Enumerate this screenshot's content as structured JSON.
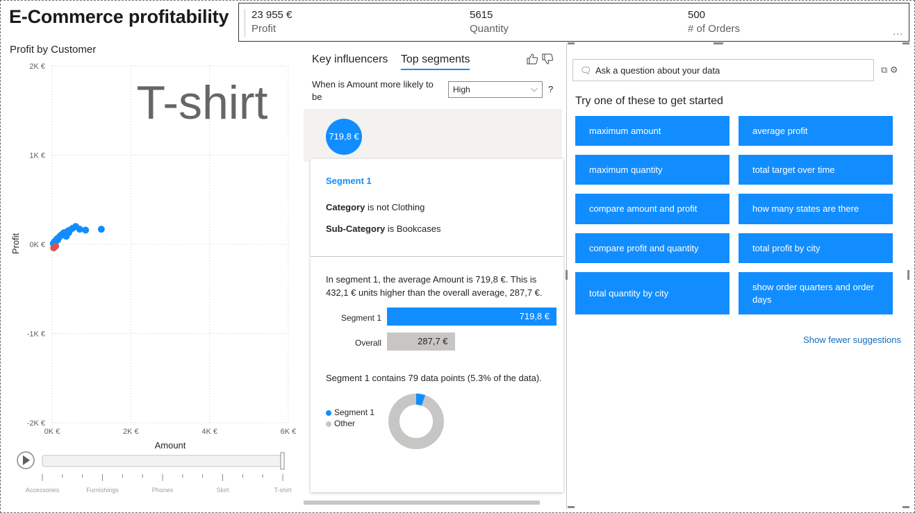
{
  "header": {
    "title": "E-Commerce profitability"
  },
  "kpis": [
    {
      "value": "23 955 €",
      "label": "Profit"
    },
    {
      "value": "5615",
      "label": "Quantity"
    },
    {
      "value": "500",
      "label": "# of Orders"
    }
  ],
  "kpi_more": "...",
  "scatter": {
    "play_axis_current": "T-shirt",
    "play_axis_categories": [
      "Accessories",
      "Furnishings",
      "Phones",
      "Skirt",
      "T-shirt"
    ]
  },
  "chart_data": {
    "type": "scatter",
    "title": "Profit by Customer",
    "xlabel": "Amount",
    "ylabel": "Profit",
    "xlim": [
      0,
      6000
    ],
    "ylim": [
      -2000,
      2000
    ],
    "x_ticks": [
      "0K €",
      "2K €",
      "4K €",
      "6K €"
    ],
    "y_ticks": [
      "2K €",
      "1K €",
      "0K €",
      "-1K €",
      "-2K €"
    ],
    "grid": true,
    "series": [
      {
        "color": "#118dff",
        "points": [
          [
            30,
            10
          ],
          [
            60,
            30
          ],
          [
            80,
            20
          ],
          [
            100,
            40
          ],
          [
            120,
            60
          ],
          [
            140,
            50
          ],
          [
            160,
            70
          ],
          [
            180,
            80
          ],
          [
            200,
            90
          ],
          [
            220,
            100
          ],
          [
            250,
            110
          ],
          [
            280,
            120
          ],
          [
            300,
            130
          ],
          [
            330,
            110
          ],
          [
            360,
            90
          ],
          [
            380,
            140
          ],
          [
            400,
            150
          ],
          [
            420,
            130
          ],
          [
            450,
            160
          ],
          [
            520,
            180
          ],
          [
            600,
            200
          ],
          [
            700,
            170
          ],
          [
            850,
            160
          ],
          [
            1250,
            170
          ]
        ]
      },
      {
        "color": "#d9534f",
        "points": [
          [
            40,
            -40
          ],
          [
            90,
            -20
          ]
        ]
      }
    ]
  },
  "influencers": {
    "tabs": [
      "Key influencers",
      "Top segments"
    ],
    "active_tab": "Top segments",
    "question": "When is Amount more likely to be",
    "selected": "High",
    "help": "?",
    "bubble": "719,8 €",
    "segment": {
      "title": "Segment 1",
      "conditions": [
        {
          "field": "Category",
          "rule": "is not Clothing"
        },
        {
          "field": "Sub-Category",
          "rule": "is Bookcases"
        }
      ],
      "description": "In segment 1, the average Amount is 719,8 €. This is 432,1 € units higher than the overall average, 287,7 €.",
      "bars": [
        {
          "label": "Segment 1",
          "value": "719,8 €",
          "raw": 719.8
        },
        {
          "label": "Overall",
          "value": "287,7 €",
          "raw": 287.7
        }
      ],
      "contains": "Segment 1 contains 79 data points (5.3% of the data).",
      "legend": [
        "Segment 1",
        "Other"
      ],
      "share": 0.053,
      "colors": {
        "segment": "#118dff",
        "other": "#c8c6c4"
      }
    }
  },
  "qa": {
    "placeholder": "Ask a question about your data",
    "try_label": "Try one of these to get started",
    "suggestions": [
      "maximum amount",
      "average profit",
      "maximum quantity",
      "total target over time",
      "compare amount and profit",
      "how many states are there",
      "compare profit and quantity",
      "total profit by city",
      "total quantity by city",
      "show order quarters and order days"
    ],
    "fewer_label": "Show fewer suggestions"
  },
  "colors": {
    "accent": "#118dff",
    "negative": "#d9534f"
  }
}
